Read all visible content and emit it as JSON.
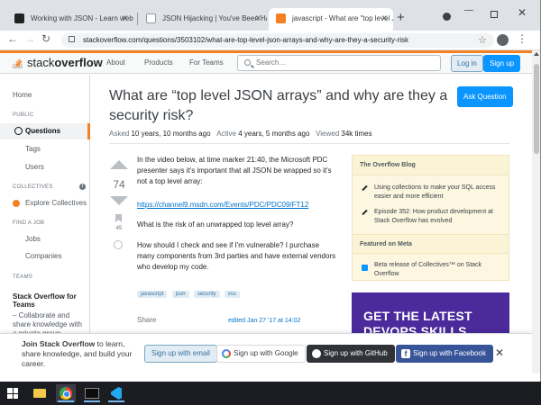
{
  "browser": {
    "tabs": [
      {
        "title": "Working with JSON - Learn web…"
      },
      {
        "title": "JSON Hijacking | You've Been Ha…"
      },
      {
        "title": "javascript - What are \"top level J…"
      }
    ],
    "new_tab": "+",
    "url": "stackoverflow.com/questions/3503102/what-are-top-level-json-arrays-and-why-are-they-a-security-risk"
  },
  "header": {
    "logo_light": "stack",
    "logo_bold": "overflow",
    "nav": [
      "About",
      "Products",
      "For Teams"
    ],
    "search_placeholder": "Search…",
    "login": "Log in",
    "signup": "Sign up"
  },
  "sidebar": {
    "home": "Home",
    "public_head": "PUBLIC",
    "questions": "Questions",
    "tags": "Tags",
    "users": "Users",
    "collectives_head": "COLLECTIVES",
    "explore_collectives": "Explore Collectives",
    "find_job_head": "FIND A JOB",
    "jobs": "Jobs",
    "companies": "Companies",
    "teams_head": "TEAMS",
    "teams_title": "Stack Overflow for Teams",
    "teams_desc": "– Collaborate and share knowledge with a private group."
  },
  "question": {
    "title": "What are “top level JSON arrays” and why are they a security risk?",
    "ask_button": "Ask Question",
    "asked_label": "Asked",
    "asked_value": "10 years, 10 months ago",
    "active_label": "Active",
    "active_value": "4 years, 5 months ago",
    "viewed_label": "Viewed",
    "viewed_value": "34k times",
    "votes": "74",
    "bookmarks": "45",
    "body_p1": "In the video below, at time marker 21:40, the Microsoft PDC presenter says it's important that all JSON be wrapped so it's not a top level array:",
    "link": "https://channel9.msdn.com/Events/PDC/PDC09/FT12",
    "body_p2": "What is the risk of an unwrapped top level array?",
    "body_p3": "How should I check and see if I'm vulnerable? I purchase many components from 3rd parties and have external vendors who develop my code.",
    "tags": [
      "javascript",
      "json",
      "security",
      "xss"
    ],
    "share": "Share",
    "edited": "edited Jan 27 '17 at 14:02"
  },
  "blog": {
    "head": "The Overflow Blog",
    "items": [
      "Using collections to make your SQL access easier and more efficient",
      "Episode 352: How product development at Stack Overflow has evolved"
    ],
    "meta_head": "Featured on Meta",
    "meta_item": "Beta release of Collectives™ on Stack Overflow"
  },
  "ad": {
    "line1": "GET THE LATEST",
    "line2": "DEVOPS SKILLS"
  },
  "join": {
    "text_bold": "Join Stack Overflow",
    "text_rest": "to learn, share knowledge, and build your career.",
    "email": "Sign up with email",
    "google": "Sign up with Google",
    "github": "Sign up with GitHub",
    "facebook": "Sign up with Facebook",
    "close": "✕"
  },
  "colors": {
    "accent": "#f48024",
    "primary": "#0a95ff",
    "link": "#0074cc"
  }
}
